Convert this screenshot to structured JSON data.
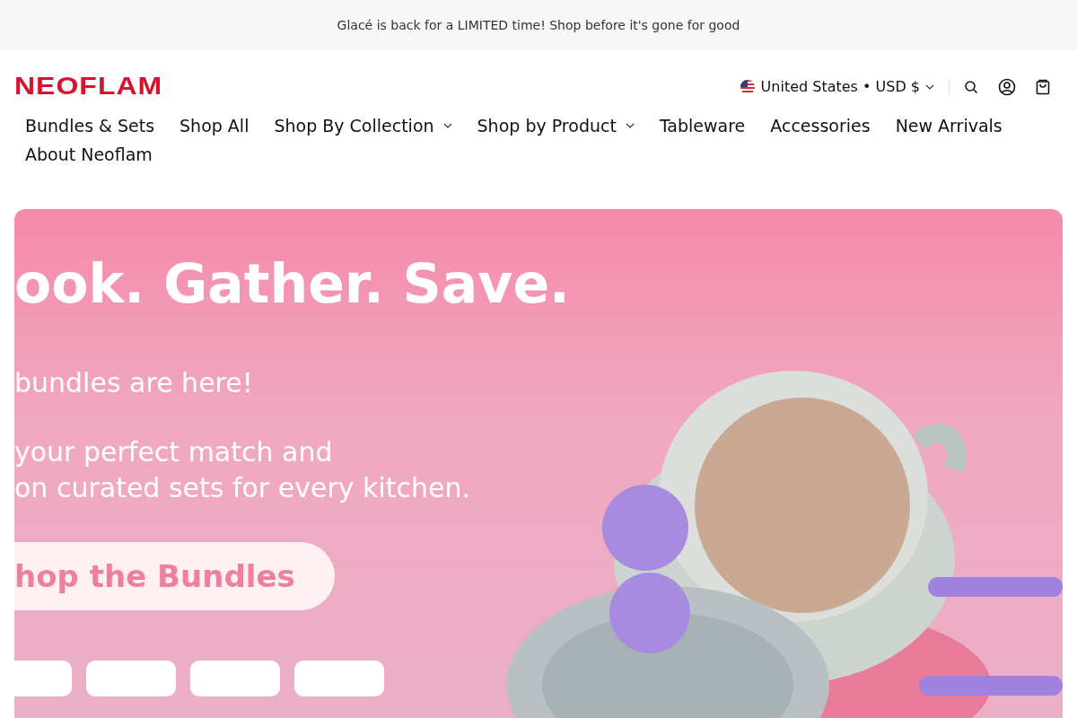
{
  "announcement": "Glacé is back for a LIMITED time! Shop before it's gone for good",
  "header": {
    "logo": "NEOFLAM",
    "locale": "United States • USD $"
  },
  "nav": [
    {
      "label": "Bundles & Sets",
      "dropdown": false
    },
    {
      "label": "Shop All",
      "dropdown": false
    },
    {
      "label": "Shop By Collection",
      "dropdown": true
    },
    {
      "label": "Shop by Product",
      "dropdown": true
    },
    {
      "label": "Tableware",
      "dropdown": false
    },
    {
      "label": "Accessories",
      "dropdown": false
    },
    {
      "label": "New Arrivals",
      "dropdown": false
    },
    {
      "label": "About Neoflam",
      "dropdown": false
    }
  ],
  "hero": {
    "headline": "ook. Gather. Save.",
    "lines": [
      "bundles are here!",
      "your perfect match and",
      "on curated sets for every kitchen."
    ],
    "cta": "hop the Bundles"
  }
}
